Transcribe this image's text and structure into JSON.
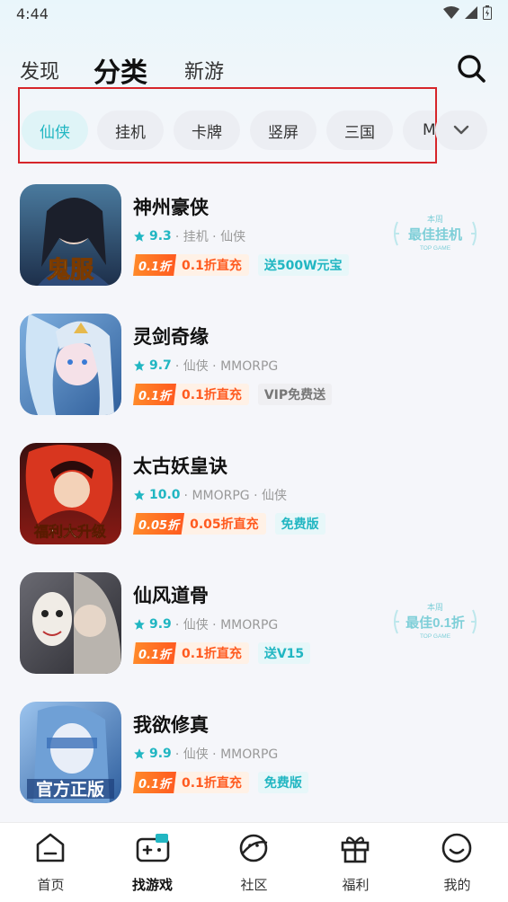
{
  "status_bar": {
    "time": "4:44"
  },
  "header": {
    "tabs": [
      {
        "label": "发现"
      },
      {
        "label": "分类"
      },
      {
        "label": "新游"
      }
    ]
  },
  "categories": {
    "chips": [
      {
        "label": "仙侠",
        "active": true
      },
      {
        "label": "挂机"
      },
      {
        "label": "卡牌"
      },
      {
        "label": "竖屏"
      },
      {
        "label": "三国"
      },
      {
        "label": "MMORPG"
      }
    ]
  },
  "games": [
    {
      "title": "神州豪侠",
      "score": "9.3",
      "meta": "· 挂机 · 仙侠",
      "discount_badge": "0.1折",
      "discount_text": "0.1折直充",
      "gift": "送500W元宝",
      "award": {
        "top": "本周",
        "main": "最佳挂机",
        "sub": "TOP GAME"
      },
      "icon_text": "鬼服"
    },
    {
      "title": "灵剑奇缘",
      "score": "9.7",
      "meta": "· 仙侠 · MMORPG",
      "discount_badge": "0.1折",
      "discount_text": "0.1折直充",
      "gift": "VIP免费送"
    },
    {
      "title": "太古妖皇诀",
      "score": "10.0",
      "meta": "· MMORPG · 仙侠",
      "discount_badge": "0.05折",
      "discount_text": "0.05折直充",
      "gift": "免费版",
      "icon_text": "福利大升级"
    },
    {
      "title": "仙风道骨",
      "score": "9.9",
      "meta": "· 仙侠 · MMORPG",
      "discount_badge": "0.1折",
      "discount_text": "0.1折直充",
      "gift": "送V15",
      "award": {
        "top": "本周",
        "main": "最佳0.1折",
        "sub": "TOP GAME"
      }
    },
    {
      "title": "我欲修真",
      "score": "9.9",
      "meta": "· 仙侠 · MMORPG",
      "discount_badge": "0.1折",
      "discount_text": "0.1折直充",
      "gift": "免费版",
      "icon_text": "官方正版"
    }
  ],
  "bottom_nav": [
    {
      "label": "首页",
      "icon": "home-icon"
    },
    {
      "label": "找游戏",
      "icon": "gamepad-icon",
      "active": true
    },
    {
      "label": "社区",
      "icon": "planet-icon"
    },
    {
      "label": "福利",
      "icon": "gift-icon"
    },
    {
      "label": "我的",
      "icon": "smile-icon"
    }
  ],
  "colors": {
    "accent": "#21b6c2",
    "discount": "#ff5a1f",
    "highlight_frame": "#d6252a"
  }
}
